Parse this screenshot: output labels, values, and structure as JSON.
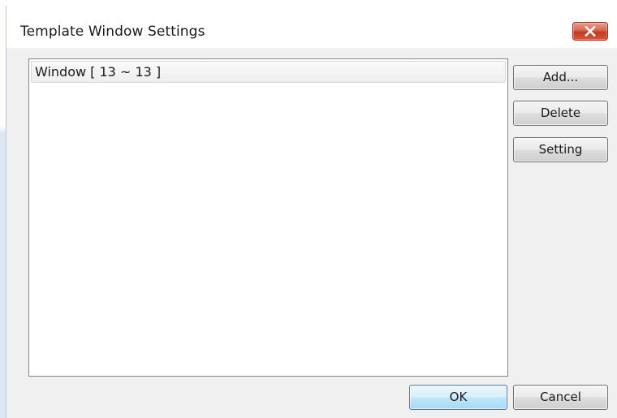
{
  "dialog": {
    "title": "Template Window Settings"
  },
  "list": {
    "items": [
      {
        "label": "Window [ 13 ~ 13 ]"
      }
    ]
  },
  "buttons": {
    "add": "Add...",
    "delete": "Delete",
    "setting": "Setting",
    "ok": "OK",
    "cancel": "Cancel"
  },
  "icons": {
    "close": "close-icon"
  },
  "colors": {
    "close_button": "#c9462c",
    "default_button_border": "#3c7fb1",
    "dialog_background": "#f0f0f0"
  }
}
